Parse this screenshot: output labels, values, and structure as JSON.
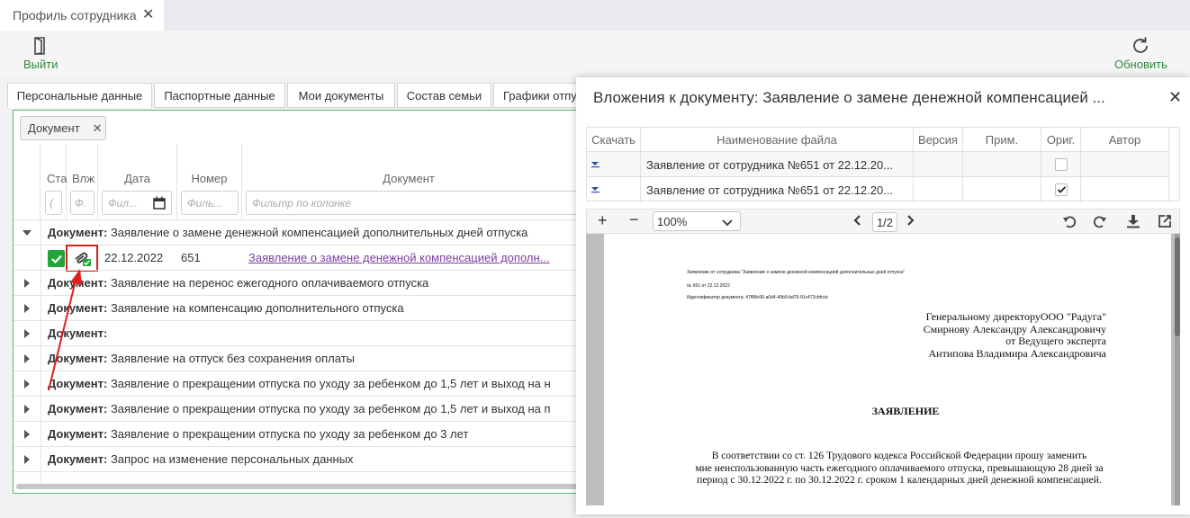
{
  "app": {
    "tab_title": "Профиль сотрудника",
    "toolbar": {
      "exit_label": "Выйти",
      "refresh_label": "Обновить"
    }
  },
  "subtabs": [
    "Персональные данные",
    "Паспортные данные",
    "Мои документы",
    "Состав семьи",
    "Графики отпу"
  ],
  "filter_chip": "Документ",
  "grid": {
    "headers": {
      "status": "Ста",
      "attach": "Влж",
      "date": "Дата",
      "number": "Номер",
      "document": "Документ"
    },
    "filters": {
      "status": "(",
      "attach": "Ф.",
      "date": "Фил...",
      "number": "Филь...",
      "document": "Фильтр по колонке"
    },
    "group_prefix": "Документ:",
    "groups": [
      "Заявление о замене денежной компенсацией дополнительных дней отпуска",
      "Заявление на перенос ежегодного оплачиваемого отпуска",
      "Заявление на компенсацию дополнительного отпуска",
      "",
      "Заявление на отпуск без сохранения оплаты",
      "Заявление о прекращении отпуска по уходу за ребенком до 1,5 лет и выход на н",
      "Заявление о прекращении отпуска по уходу за ребенком до 1,5 лет и выход на п",
      "Заявление о прекращении отпуска по уходу за ребенком до 3 лет",
      "Запрос на изменение персональных данных"
    ],
    "detail_row": {
      "date": "22.12.2022",
      "number": "651",
      "document": "Заявление о замене денежной компенсацией дополн..."
    }
  },
  "modal": {
    "title": "Вложения к документу: Заявление о замене денежной компенсацией ...",
    "table": {
      "headers": [
        "Скачать",
        "Наименование файла",
        "Версия",
        "Прим.",
        "Ориг.",
        "Автор"
      ],
      "rows": [
        {
          "name": "Заявление от сотрудника №651 от 22.12.20...",
          "original": false
        },
        {
          "name": "Заявление от сотрудника №651 от 22.12.20...",
          "original": true
        }
      ]
    },
    "pdf": {
      "zoom": "100%",
      "page": "1/2",
      "doc_line1": "Заявление от сотрудника \"Заявление о замене денежной компенсацией дополнительных дней отпуска\"",
      "doc_line2": "№ 651 от 22.12.2022",
      "doc_line3": "Идентификатор документа: 47f88c06-a0d4-49b0-bd79-91c472cbfccb",
      "addr1": "Генеральному директоруООО \"Радуга\"",
      "addr2": "Смирнову Александру Александровичу",
      "addr3": "от Ведущего эксперта",
      "addr4": "Антипова Владимира Александровича",
      "heading": "ЗАЯВЛЕНИЕ",
      "body1": "В соответствии со ст. 126 Трудового кодекса Российской Федерации прошу заменить",
      "body2": "мне неиспользованную часть ежегодного оплачиваемого отпуска, превышающую 28 дней за",
      "body3": "период с  30.12.2022 г. по 30.12.2022 г. сроком 1 календарных дней денежной компенсацией."
    }
  },
  "colors": {
    "accent": "#2e8b3c",
    "link": "#7b3fa0",
    "annotation": "#e02020"
  }
}
